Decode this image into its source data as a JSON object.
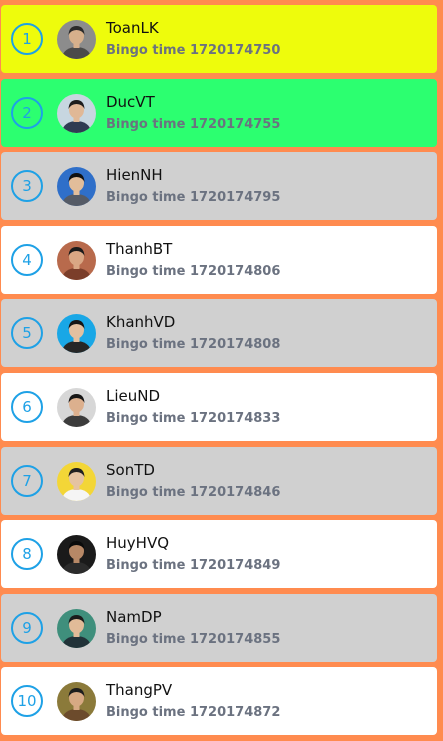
{
  "colors": {
    "page_background": "#ff8b4f",
    "rank_ring": "#1ea1e6",
    "time_text": "#6b7280"
  },
  "leaderboard": {
    "entries": [
      {
        "rank": "1",
        "name": "ToanLK",
        "time_label": "Bingo time 1720174750",
        "row_color": "#eefc0c",
        "avatar_icon": "user-avatar-icon",
        "avatar_bg": "#8c8c8c",
        "skin": "#d6b08c",
        "hair": "#2a2a2a",
        "shirt": "#4a4a4a"
      },
      {
        "rank": "2",
        "name": "DucVT",
        "time_label": "Bingo time 1720174755",
        "row_color": "#2cff70",
        "avatar_icon": "user-avatar-icon",
        "avatar_bg": "#c7d6e0",
        "skin": "#e0b896",
        "hair": "#1d1d1d",
        "shirt": "#2f3b52"
      },
      {
        "rank": "3",
        "name": "HienNH",
        "time_label": "Bingo time 1720174795",
        "row_color": "#d0d0d0",
        "avatar_icon": "user-avatar-icon",
        "avatar_bg": "#2f6fc9",
        "skin": "#e2bd9a",
        "hair": "#111111",
        "shirt": "#555b66"
      },
      {
        "rank": "4",
        "name": "ThanhBT",
        "time_label": "Bingo time 1720174806",
        "row_color": "#ffffff",
        "avatar_icon": "user-avatar-icon",
        "avatar_bg": "#b86a4c",
        "skin": "#d9a784",
        "hair": "#1a1a1a",
        "shirt": "#7b3e2a"
      },
      {
        "rank": "5",
        "name": "KhanhVD",
        "time_label": "Bingo time 1720174808",
        "row_color": "#d0d0d0",
        "avatar_icon": "user-avatar-icon",
        "avatar_bg": "#19a7e6",
        "skin": "#e3c0a0",
        "hair": "#151515",
        "shirt": "#262626"
      },
      {
        "rank": "6",
        "name": "LieuND",
        "time_label": "Bingo time 1720174833",
        "row_color": "#ffffff",
        "avatar_icon": "user-avatar-icon",
        "avatar_bg": "#d7d7d7",
        "skin": "#dcb08e",
        "hair": "#161616",
        "shirt": "#3c3c3c"
      },
      {
        "rank": "7",
        "name": "SonTD",
        "time_label": "Bingo time 1720174846",
        "row_color": "#d0d0d0",
        "avatar_icon": "user-avatar-icon",
        "avatar_bg": "#f3d637",
        "skin": "#e5c3a2",
        "hair": "#202020",
        "shirt": "#f5f5f5"
      },
      {
        "rank": "8",
        "name": "HuyHVQ",
        "time_label": "Bingo time 1720174849",
        "row_color": "#ffffff",
        "avatar_icon": "user-avatar-icon",
        "avatar_bg": "#1a1a1a",
        "skin": "#b78866",
        "hair": "#0b0b0b",
        "shirt": "#2b2b2b"
      },
      {
        "rank": "9",
        "name": "NamDP",
        "time_label": "Bingo time 1720174855",
        "row_color": "#d0d0d0",
        "avatar_icon": "user-avatar-icon",
        "avatar_bg": "#3f8f7c",
        "skin": "#e1bb98",
        "hair": "#1b1b1b",
        "shirt": "#213238"
      },
      {
        "rank": "10",
        "name": "ThangPV",
        "time_label": "Bingo time 1720174872",
        "row_color": "#ffffff",
        "avatar_icon": "user-avatar-icon",
        "avatar_bg": "#8b7a3a",
        "skin": "#d7a983",
        "hair": "#1d1d1d",
        "shirt": "#6c4b2c"
      }
    ]
  }
}
